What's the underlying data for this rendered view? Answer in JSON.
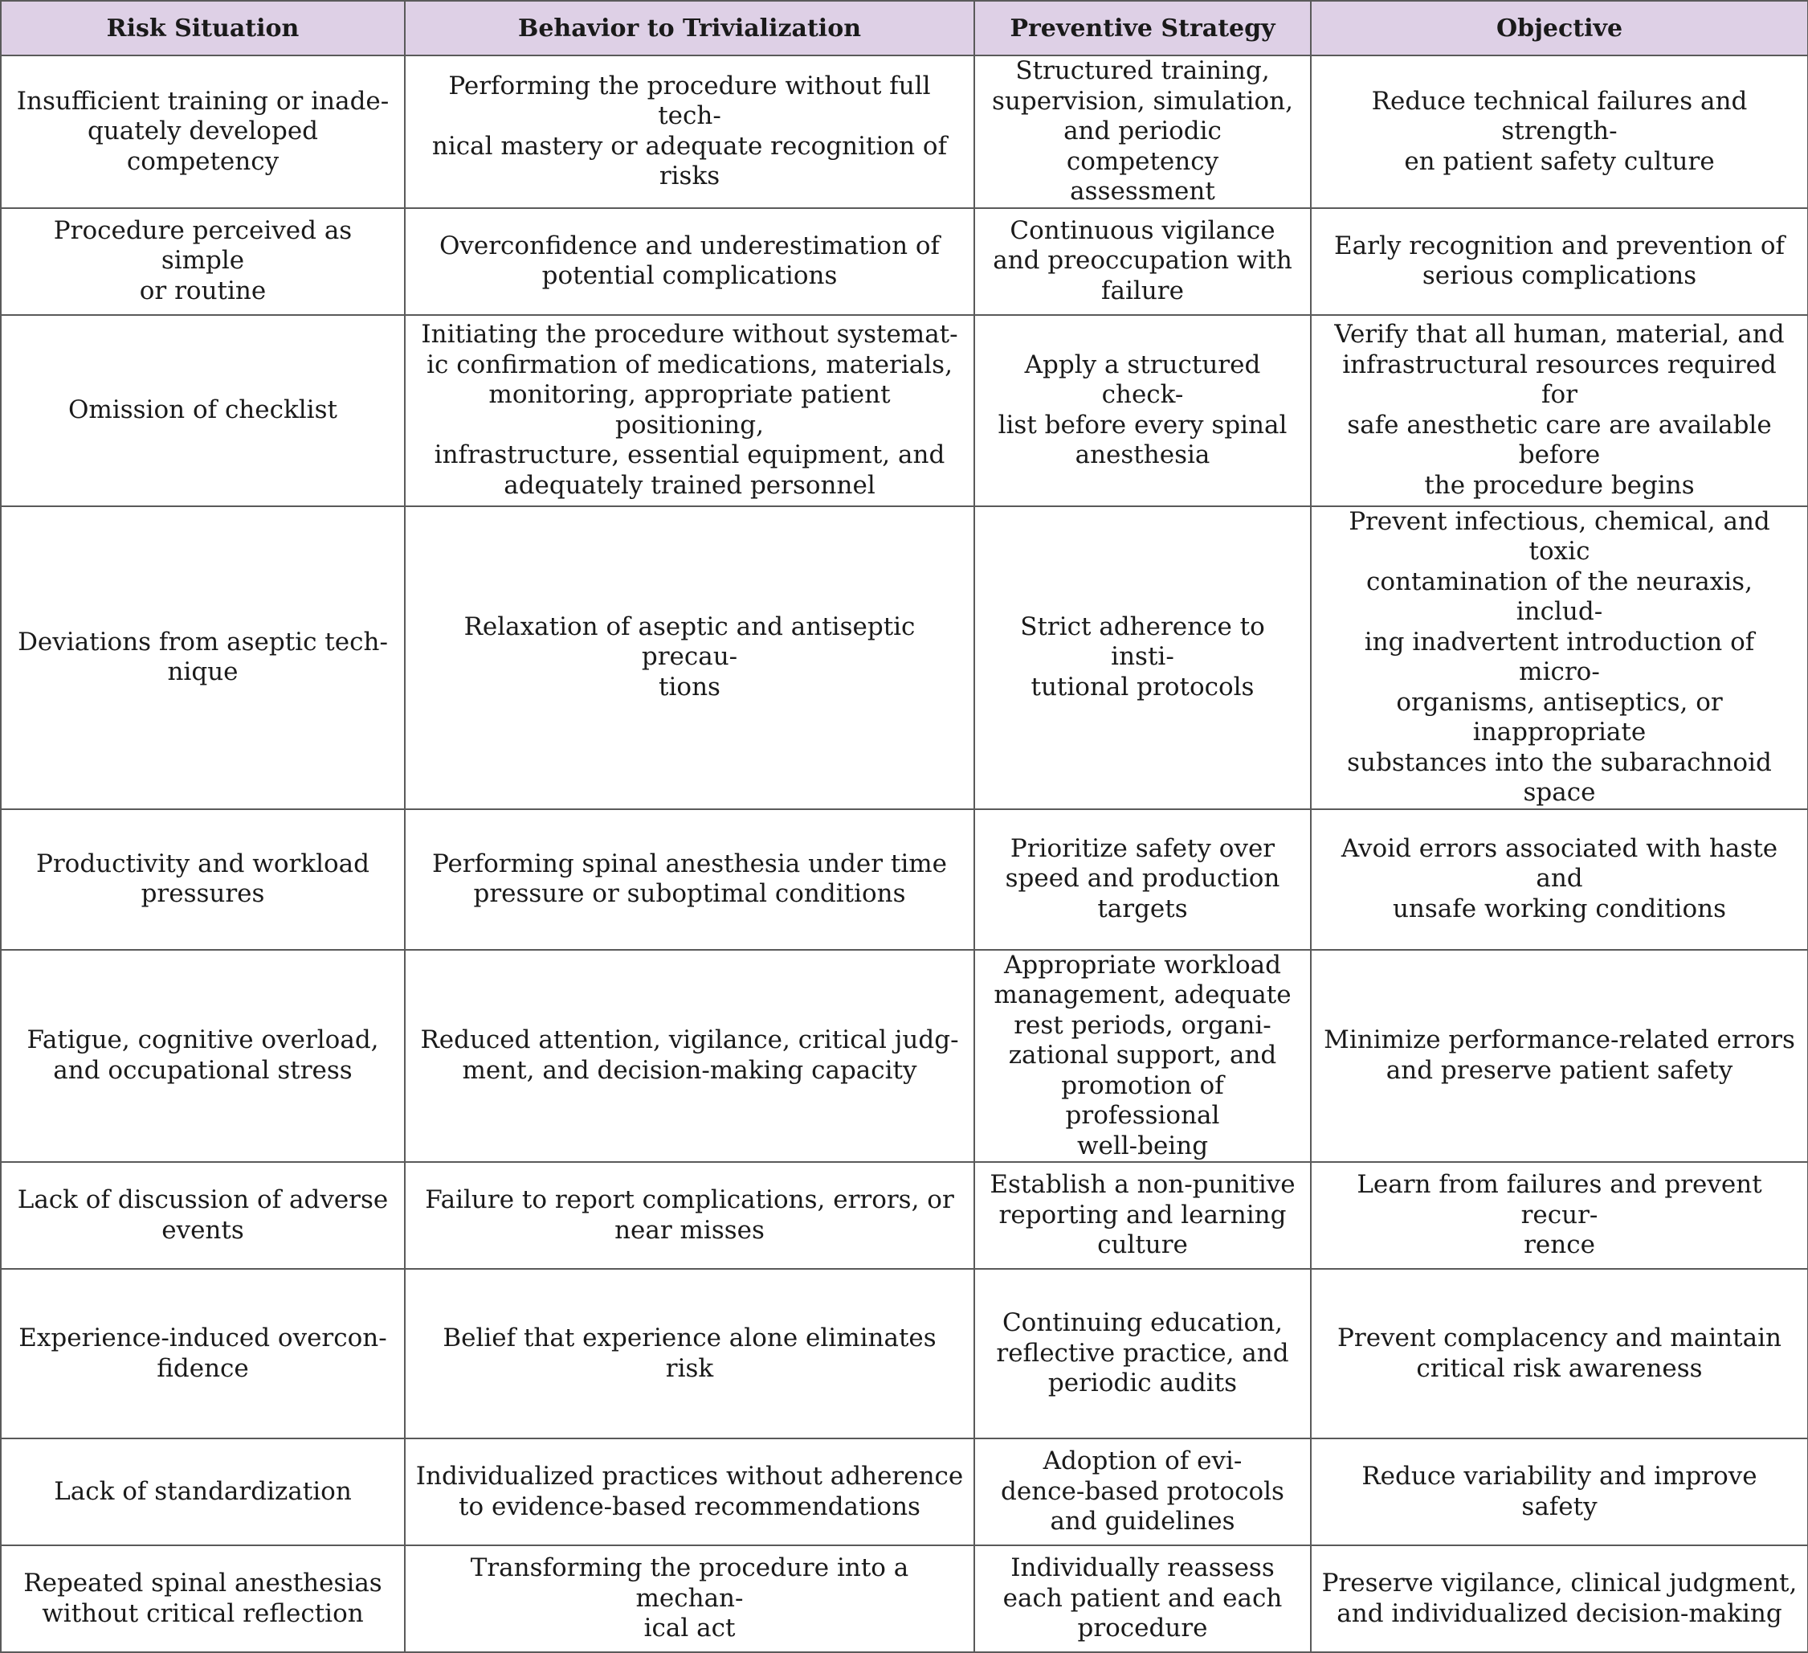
{
  "table": {
    "headers": [
      "Risk Situation",
      "Behavior to Trivialization",
      "Preventive Strategy",
      "Objective"
    ],
    "rows": [
      [
        "Insufficient training or inade-\nquately developed competency",
        "Performing the procedure without full tech-\nnical mastery or adequate recognition of risks",
        "Structured training,\nsupervision, simulation,\nand periodic competency\nassessment",
        "Reduce technical failures and strength-\nen patient safety culture"
      ],
      [
        "Procedure perceived as simple\nor routine",
        "Overconfidence and underestimation of\npotential complications",
        "Continuous vigilance\nand preoccupation with\nfailure",
        "Early recognition and prevention of\nserious complications"
      ],
      [
        "Omission of checklist",
        "Initiating the procedure without systemat-\nic confirmation of medications, materials,\nmonitoring, appropriate patient positioning,\ninfrastructure, essential equipment, and\nadequately trained personnel",
        "Apply a structured check-\nlist before every spinal\nanesthesia",
        "Verify that all human, material, and\ninfrastructural resources required for\nsafe anesthetic care are available before\nthe procedure begins"
      ],
      [
        "Deviations from aseptic tech-\nnique",
        "Relaxation of aseptic and antiseptic precau-\ntions",
        "Strict adherence to insti-\ntutional protocols",
        "Prevent infectious, chemical, and toxic\ncontamination of the neuraxis, includ-\ning inadvertent introduction of micro-\norganisms, antiseptics, or inappropriate\nsubstances into the subarachnoid space"
      ],
      [
        "Productivity and workload\npressures",
        "Performing spinal anesthesia under time\npressure or suboptimal conditions",
        "Prioritize safety over\nspeed and production\ntargets",
        "Avoid errors associated with haste and\nunsafe working conditions"
      ],
      [
        "Fatigue, cognitive overload,\nand occupational stress",
        "Reduced attention, vigilance, critical judg-\nment, and decision-making capacity",
        "Appropriate workload\nmanagement, adequate\nrest periods, organi-\nzational support, and\npromotion of professional\nwell-being",
        "Minimize performance-related errors\nand preserve patient safety"
      ],
      [
        "Lack of discussion of adverse\nevents",
        "Failure to report complications, errors, or\nnear misses",
        "Establish a non-punitive\nreporting and learning\nculture",
        "Learn from failures and prevent recur-\nrence"
      ],
      [
        "Experience-induced overcon-\nfidence",
        "Belief that experience alone eliminates risk",
        "Continuing education,\nreflective practice, and\nperiodic audits",
        "Prevent complacency and maintain\ncritical risk awareness"
      ],
      [
        "Lack of standardization",
        "Individualized practices without adherence\nto evidence-based recommendations",
        "Adoption of evi-\ndence-based protocols\nand guidelines",
        "Reduce variability and improve safety"
      ],
      [
        "Repeated spinal anesthesias\nwithout critical reflection",
        "Transforming the procedure into a mechan-\nical act",
        "Individually reassess\neach patient and each\nprocedure",
        "Preserve vigilance, clinical judgment,\nand individualized decision-making"
      ]
    ]
  }
}
